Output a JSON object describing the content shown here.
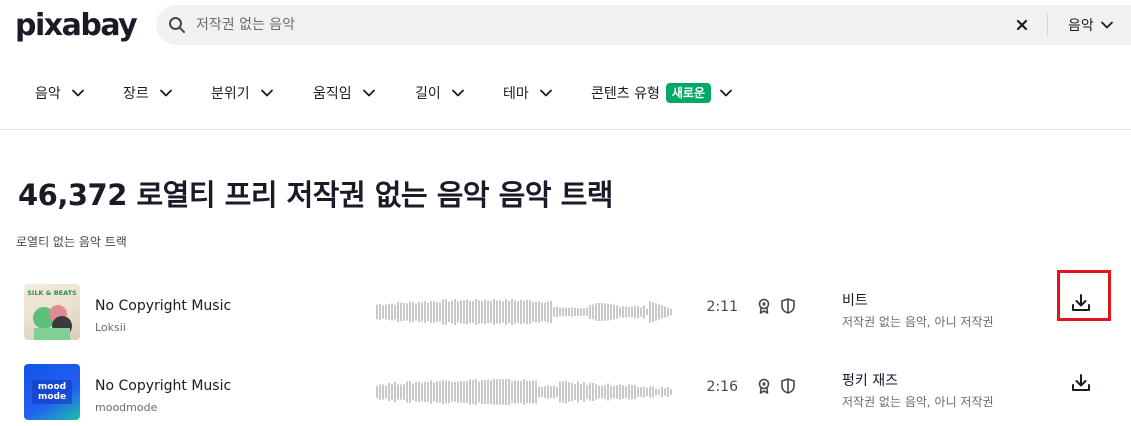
{
  "header": {
    "logo": "pixabay",
    "search_placeholder": "저작권 없는 음악",
    "search_value": "",
    "scope_label": "음악"
  },
  "filters": [
    {
      "label": "음악"
    },
    {
      "label": "장르"
    },
    {
      "label": "분위기"
    },
    {
      "label": "움직임"
    },
    {
      "label": "길이"
    },
    {
      "label": "테마"
    },
    {
      "label": "콘텐츠 유형",
      "badge": "새로운"
    }
  ],
  "page": {
    "title": "46,372 로열티 프리 저작권 없는 음악 음악 트랙",
    "subtitle": "로열티 없는 음악 트랙"
  },
  "tracks": [
    {
      "title": "No Copyright Music",
      "artist": "Loksii",
      "duration": "2:11",
      "genre": "비트",
      "tags": "저작권 없는 음악, 아니 저작권",
      "cover_text": "SILK & BEATS"
    },
    {
      "title": "No Copyright Music",
      "artist": "moodmode",
      "duration": "2:16",
      "genre": "펑키 재즈",
      "tags": "저작권 없는 음악, 아니 저작권",
      "cover_text": "mood mode"
    }
  ],
  "colors": {
    "text": "#191b26",
    "muted": "#6a6c75",
    "badge": "#02a965",
    "highlight": "#e0141c",
    "waveform": "#c9c9cc"
  },
  "icons": {
    "search": "search-icon",
    "clear": "close-icon",
    "chevron": "chevron-down-icon",
    "award": "award-icon",
    "license": "shield-icon",
    "download": "download-icon"
  }
}
